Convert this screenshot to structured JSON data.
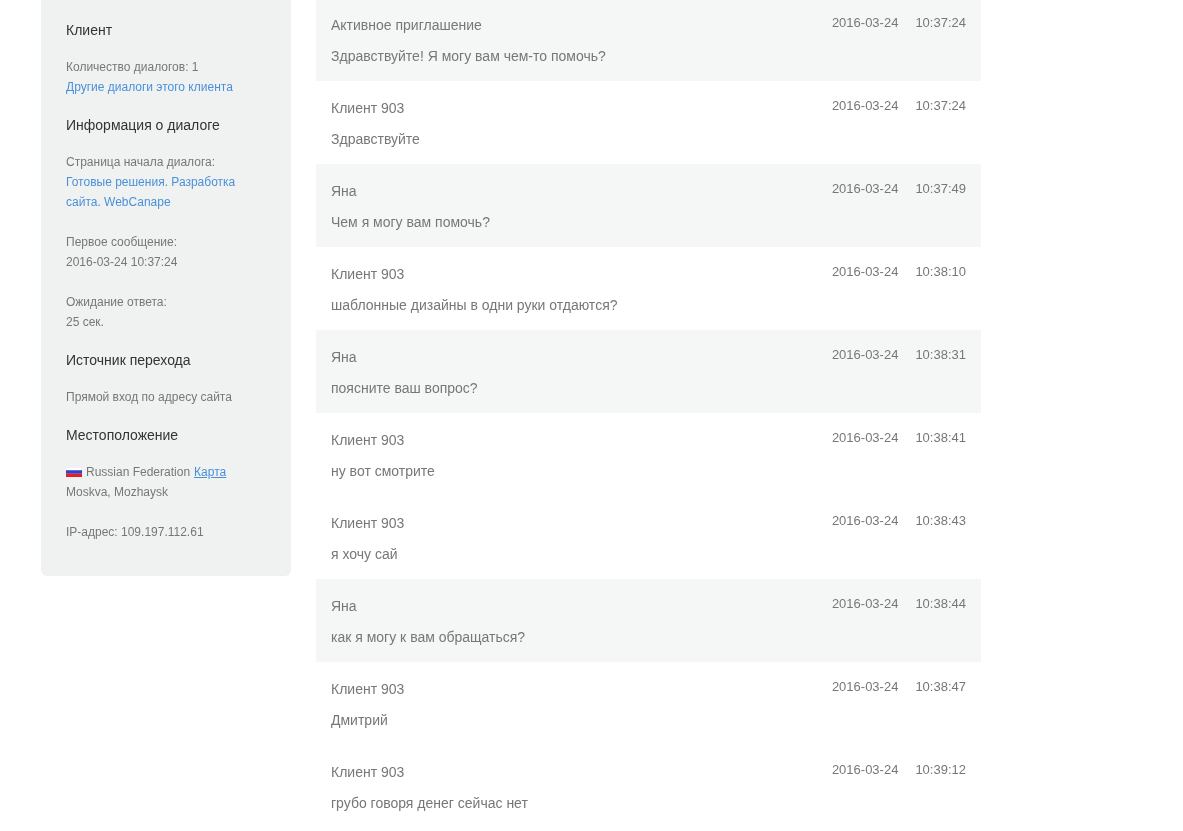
{
  "sidebar": {
    "sections": [
      {
        "title": "Клиент",
        "blocks": [
          [
            [
              {
                "kind": "text",
                "text": "Количество диалогов: 1"
              }
            ],
            [
              {
                "kind": "link",
                "text": "Другие диалоги этого клиента"
              }
            ]
          ]
        ]
      },
      {
        "title": "Информация о диалоге",
        "blocks": [
          [
            [
              {
                "kind": "text",
                "text": "Страница начала диалога:"
              }
            ],
            [
              {
                "kind": "link",
                "text": "Готовые решения. Разработка сайта. WebCanape"
              }
            ]
          ],
          [
            [
              {
                "kind": "text",
                "text": "Первое сообщение:"
              }
            ],
            [
              {
                "kind": "text",
                "text": "2016-03-24 10:37:24"
              }
            ]
          ],
          [
            [
              {
                "kind": "text",
                "text": "Ожидание ответа:"
              }
            ],
            [
              {
                "kind": "text",
                "text": "25 сек."
              }
            ]
          ]
        ]
      },
      {
        "title": "Источник перехода",
        "blocks": [
          [
            [
              {
                "kind": "text",
                "text": "Прямой вход по адресу сайта"
              }
            ]
          ]
        ]
      },
      {
        "title": "Местоположение",
        "blocks": [
          [
            [
              {
                "kind": "flag"
              },
              {
                "kind": "text",
                "text": "Russian Federation"
              },
              {
                "kind": "map-link",
                "text": "Карта"
              }
            ],
            [
              {
                "kind": "text",
                "text": "Moskva, Mozhaysk"
              }
            ]
          ],
          [
            [
              {
                "kind": "text",
                "text": "IP-адрес: 109.197.112.61"
              }
            ]
          ]
        ]
      }
    ]
  },
  "messages": [
    {
      "kind": "invitation",
      "author": "Активное приглашение",
      "date": "2016-03-24",
      "time": "10:37:24",
      "text": "Здравствуйте! Я могу вам чем-то помочь?"
    },
    {
      "kind": "client",
      "author": "Клиент 903",
      "date": "2016-03-24",
      "time": "10:37:24",
      "text": "Здравствуйте"
    },
    {
      "kind": "operator",
      "author": "Яна",
      "date": "2016-03-24",
      "time": "10:37:49",
      "text": "Чем я могу вам помочь?"
    },
    {
      "kind": "client",
      "author": "Клиент 903",
      "date": "2016-03-24",
      "time": "10:38:10",
      "text": "шаблонные дизайны в одни руки отдаются?"
    },
    {
      "kind": "operator",
      "author": "Яна",
      "date": "2016-03-24",
      "time": "10:38:31",
      "text": "поясните ваш вопрос?"
    },
    {
      "kind": "client",
      "author": "Клиент 903",
      "date": "2016-03-24",
      "time": "10:38:41",
      "text": "ну вот смотрите"
    },
    {
      "kind": "client",
      "author": "Клиент 903",
      "date": "2016-03-24",
      "time": "10:38:43",
      "text": "я хочу сай"
    },
    {
      "kind": "operator",
      "author": "Яна",
      "date": "2016-03-24",
      "time": "10:38:44",
      "text": "как я могу к вам обращаться?"
    },
    {
      "kind": "client",
      "author": "Клиент 903",
      "date": "2016-03-24",
      "time": "10:38:47",
      "text": "Дмитрий"
    },
    {
      "kind": "client",
      "author": "Клиент 903",
      "date": "2016-03-24",
      "time": "10:39:12",
      "text": "грубо говоря денег сейчас нет"
    }
  ]
}
